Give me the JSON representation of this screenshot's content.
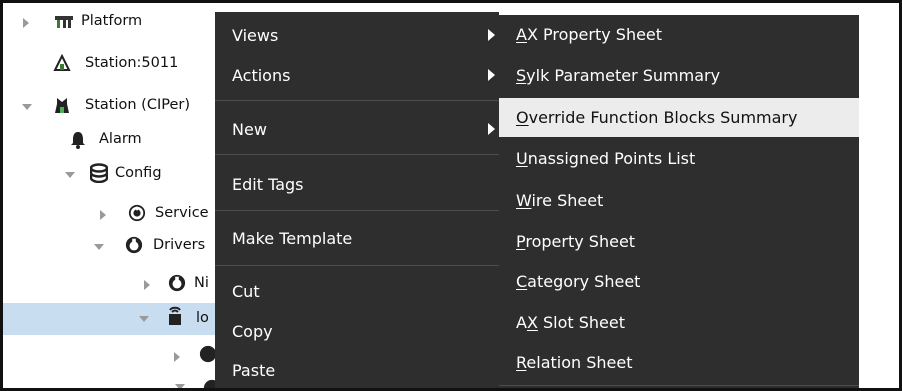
{
  "tree": {
    "rows": [
      {
        "label": "Platform",
        "icon": "platform-icon",
        "twisty": "right"
      },
      {
        "label": "Station:5011",
        "icon": "station-icon",
        "twisty": "none"
      },
      {
        "label": "Station (CIPer)",
        "icon": "station-icon",
        "twisty": "down"
      },
      {
        "label": "Alarm",
        "icon": "bell-icon",
        "twisty": "none"
      },
      {
        "label": "Config",
        "icon": "database-icon",
        "twisty": "down"
      },
      {
        "label": "Service",
        "icon": "services-icon",
        "twisty": "right"
      },
      {
        "label": "Drivers",
        "icon": "drivers-icon",
        "twisty": "down"
      },
      {
        "label": "Ni",
        "icon": "network-icon",
        "twisty": "right"
      },
      {
        "label": "lo",
        "icon": "device-icon",
        "twisty": "down",
        "selected": true
      }
    ]
  },
  "menu": {
    "items": [
      {
        "label": "Views",
        "submenu": true
      },
      {
        "label": "Actions",
        "submenu": true
      },
      {
        "label": "New",
        "submenu": true
      },
      {
        "label": "Edit Tags",
        "submenu": false
      },
      {
        "label": "Make Template",
        "submenu": false
      },
      {
        "label": "Cut",
        "submenu": false
      },
      {
        "label": "Copy",
        "submenu": false
      },
      {
        "label": "Paste",
        "submenu": false
      }
    ]
  },
  "submenu": {
    "items": [
      {
        "label": "AX Property Sheet",
        "u": "A",
        "rest": "X Property Sheet"
      },
      {
        "label": "Sylk Parameter Summary",
        "u": "S",
        "rest": "ylk Parameter Summary"
      },
      {
        "label": "Override Function Blocks Summary",
        "u": "O",
        "rest": "verride Function Blocks Summary",
        "highlighted": true
      },
      {
        "label": "Unassigned Points List",
        "u": "U",
        "rest": "nassigned Points List"
      },
      {
        "label": "Wire Sheet",
        "u": "W",
        "rest": "ire Sheet"
      },
      {
        "label": "Property Sheet",
        "u": "P",
        "rest": "roperty Sheet"
      },
      {
        "label": "Category Sheet",
        "u": "C",
        "rest": "ategory Sheet"
      },
      {
        "label": "AX Slot Sheet",
        "u": "X",
        "pre": "A",
        "rest": " Slot Sheet"
      },
      {
        "label": "Relation Sheet",
        "u": "R",
        "rest": "elation Sheet"
      }
    ]
  },
  "colors": {
    "menu_bg": "#2e2e2e",
    "menu_text": "#ffffff",
    "highlight_bg": "#ececec",
    "selection_bg": "#c9ddf1"
  }
}
